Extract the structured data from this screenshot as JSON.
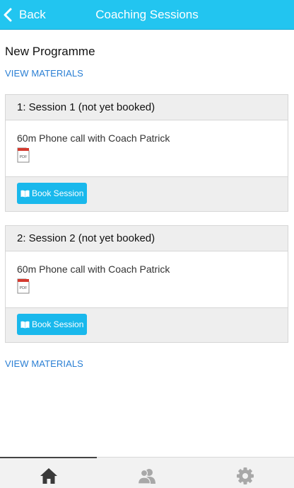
{
  "navbar": {
    "back_label": "Back",
    "title": "Coaching Sessions"
  },
  "programme": {
    "title": "New Programme",
    "view_materials_top": "VIEW MATERIALS",
    "view_materials_bottom": "VIEW MATERIALS"
  },
  "sessions": [
    {
      "header": "1: Session 1 (not yet booked)",
      "description": "60m Phone call with Coach Patrick",
      "attachment_icon": "pdf-icon",
      "button_label": "Book Session"
    },
    {
      "header": "2: Session 2 (not yet booked)",
      "description": "60m Phone call with Coach Patrick",
      "attachment_icon": "pdf-icon",
      "button_label": "Book Session"
    }
  ],
  "tabbar": {
    "tabs": [
      {
        "icon": "home-icon",
        "active": true
      },
      {
        "icon": "users-icon",
        "active": false
      },
      {
        "icon": "gear-icon",
        "active": false
      }
    ]
  },
  "colors": {
    "accent": "#22c5f0",
    "button": "#19b8ec",
    "link": "#2a7fd4"
  }
}
